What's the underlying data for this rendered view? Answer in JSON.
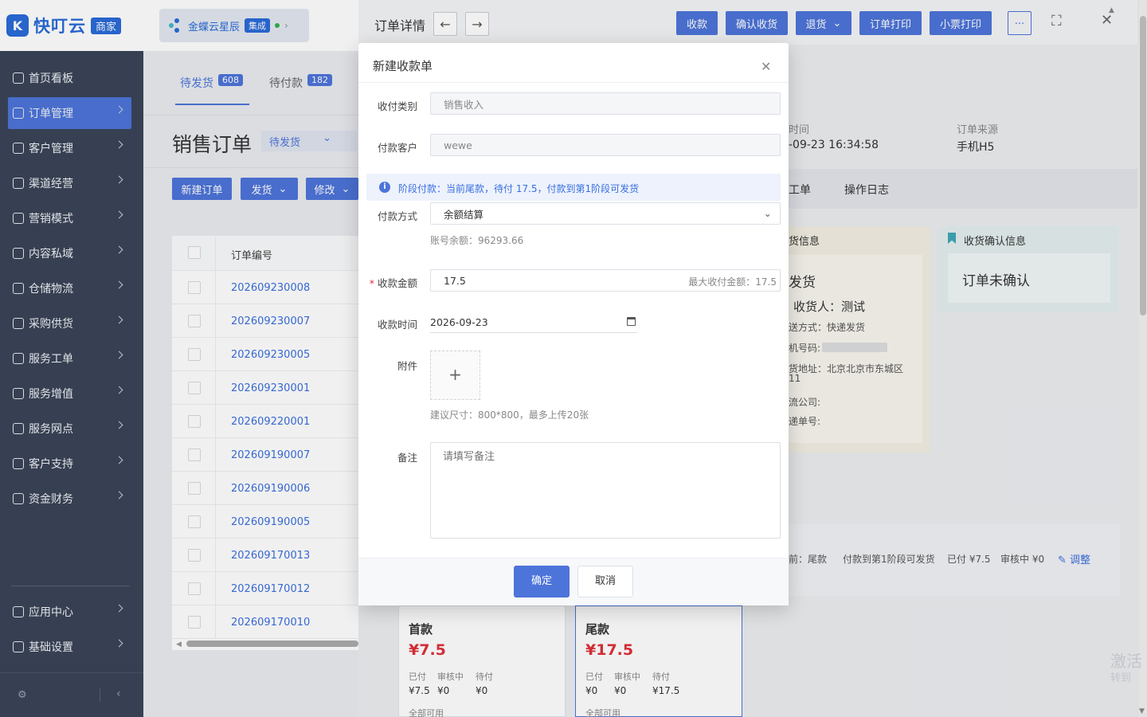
{
  "app": {
    "logo_text": "快叮云",
    "logo_badge": "商家",
    "partner_name": "金蝶云星辰",
    "partner_tag": "集成"
  },
  "sidebar": {
    "items": [
      {
        "label": "首页看板"
      },
      {
        "label": "订单管理"
      },
      {
        "label": "客户管理"
      },
      {
        "label": "渠道经营"
      },
      {
        "label": "营销模式"
      },
      {
        "label": "内容私域"
      },
      {
        "label": "仓储物流"
      },
      {
        "label": "采购供货"
      },
      {
        "label": "服务工单"
      },
      {
        "label": "服务增值"
      },
      {
        "label": "服务网点"
      },
      {
        "label": "客户支持"
      },
      {
        "label": "资金财务"
      }
    ],
    "bottom_items": [
      {
        "label": "应用中心"
      },
      {
        "label": "基础设置"
      }
    ],
    "collapse_icon": "chevron-left"
  },
  "orders_page": {
    "tabs": [
      {
        "label": "待发货",
        "count": "608"
      },
      {
        "label": "待付款",
        "count": "182"
      }
    ],
    "title": "销售订单",
    "status_filter": "待发货",
    "actions": {
      "new": "新建订单",
      "ship": "发货",
      "modify": "修改"
    },
    "column_order_no": "订单编号",
    "orders": [
      "202609230008",
      "202609230007",
      "202609230005",
      "202609230001",
      "202609220001",
      "202609190007",
      "202609190006",
      "202609190005",
      "202609170013",
      "202609170012",
      "202609170010"
    ]
  },
  "drawer": {
    "title": "订单详情",
    "buttons": {
      "collect": "收款",
      "confirm_receipt": "确认收货",
      "return": "退货",
      "print_order": "订单打印",
      "print_receipt": "小票打印",
      "more": "..."
    },
    "time_label": "时间",
    "time_value": "-09-23 16:34:58",
    "source_label": "订单来源",
    "source_value": "手机H5",
    "tabs": {
      "workorder": "工单",
      "log": "操作日志"
    },
    "shipping": {
      "header": "货信息",
      "status": "发货",
      "receiver": "收货人：测试",
      "method": "送方式：快递发货",
      "phone_label": "机号码:",
      "address": "货地址：北京北京市东城区",
      "address2": "11",
      "company": "流公司:",
      "tracking": "递单号:"
    },
    "receipt_confirm": {
      "header": "收货确认信息",
      "status": "订单未确认"
    },
    "payment_summary": {
      "stage": "前：尾款",
      "note": "付款到第1阶段可发货",
      "paid": "已付 ¥7.5",
      "reviewing": "审核中 ¥0",
      "adjust": "调整"
    },
    "stages": [
      {
        "name": "首款",
        "amount": "¥7.5",
        "paid_label": "已付",
        "review_label": "审核中",
        "pending_label": "待付",
        "paid": "¥7.5",
        "review": "¥0",
        "pending": "¥0",
        "footer": "全部可用"
      },
      {
        "name": "尾款",
        "amount": "¥17.5",
        "paid_label": "已付",
        "review_label": "审核中",
        "pending_label": "待付",
        "paid": "¥0",
        "review": "¥0",
        "pending": "¥17.5",
        "footer": "全部可用"
      }
    ]
  },
  "modal": {
    "title": "新建收款单",
    "fields": {
      "category_label": "收付类别",
      "category_value": "销售收入",
      "customer_label": "付款客户",
      "customer_value": "wewe",
      "notice": "阶段付款：当前尾款，待付 17.5，付款到第1阶段可发货",
      "method_label": "付款方式",
      "method_value": "余额结算",
      "balance_hint": "账号余额：96293.66",
      "amount_label": "收款金额",
      "amount_value": "17.5",
      "amount_max": "最大收付金额：17.5",
      "time_label": "收款时间",
      "time_value": "2026-09-23",
      "attach_label": "附件",
      "attach_hint": "建议尺寸：800*800，最多上传20张",
      "remark_label": "备注",
      "remark_placeholder": "请填写备注"
    },
    "confirm": "确定",
    "cancel": "取消"
  },
  "watermark": {
    "line1": "激活",
    "line2": "转到"
  },
  "colors": {
    "primary": "#4d74d9",
    "sidebar": "#3b4458",
    "price_red": "#e0303a"
  }
}
